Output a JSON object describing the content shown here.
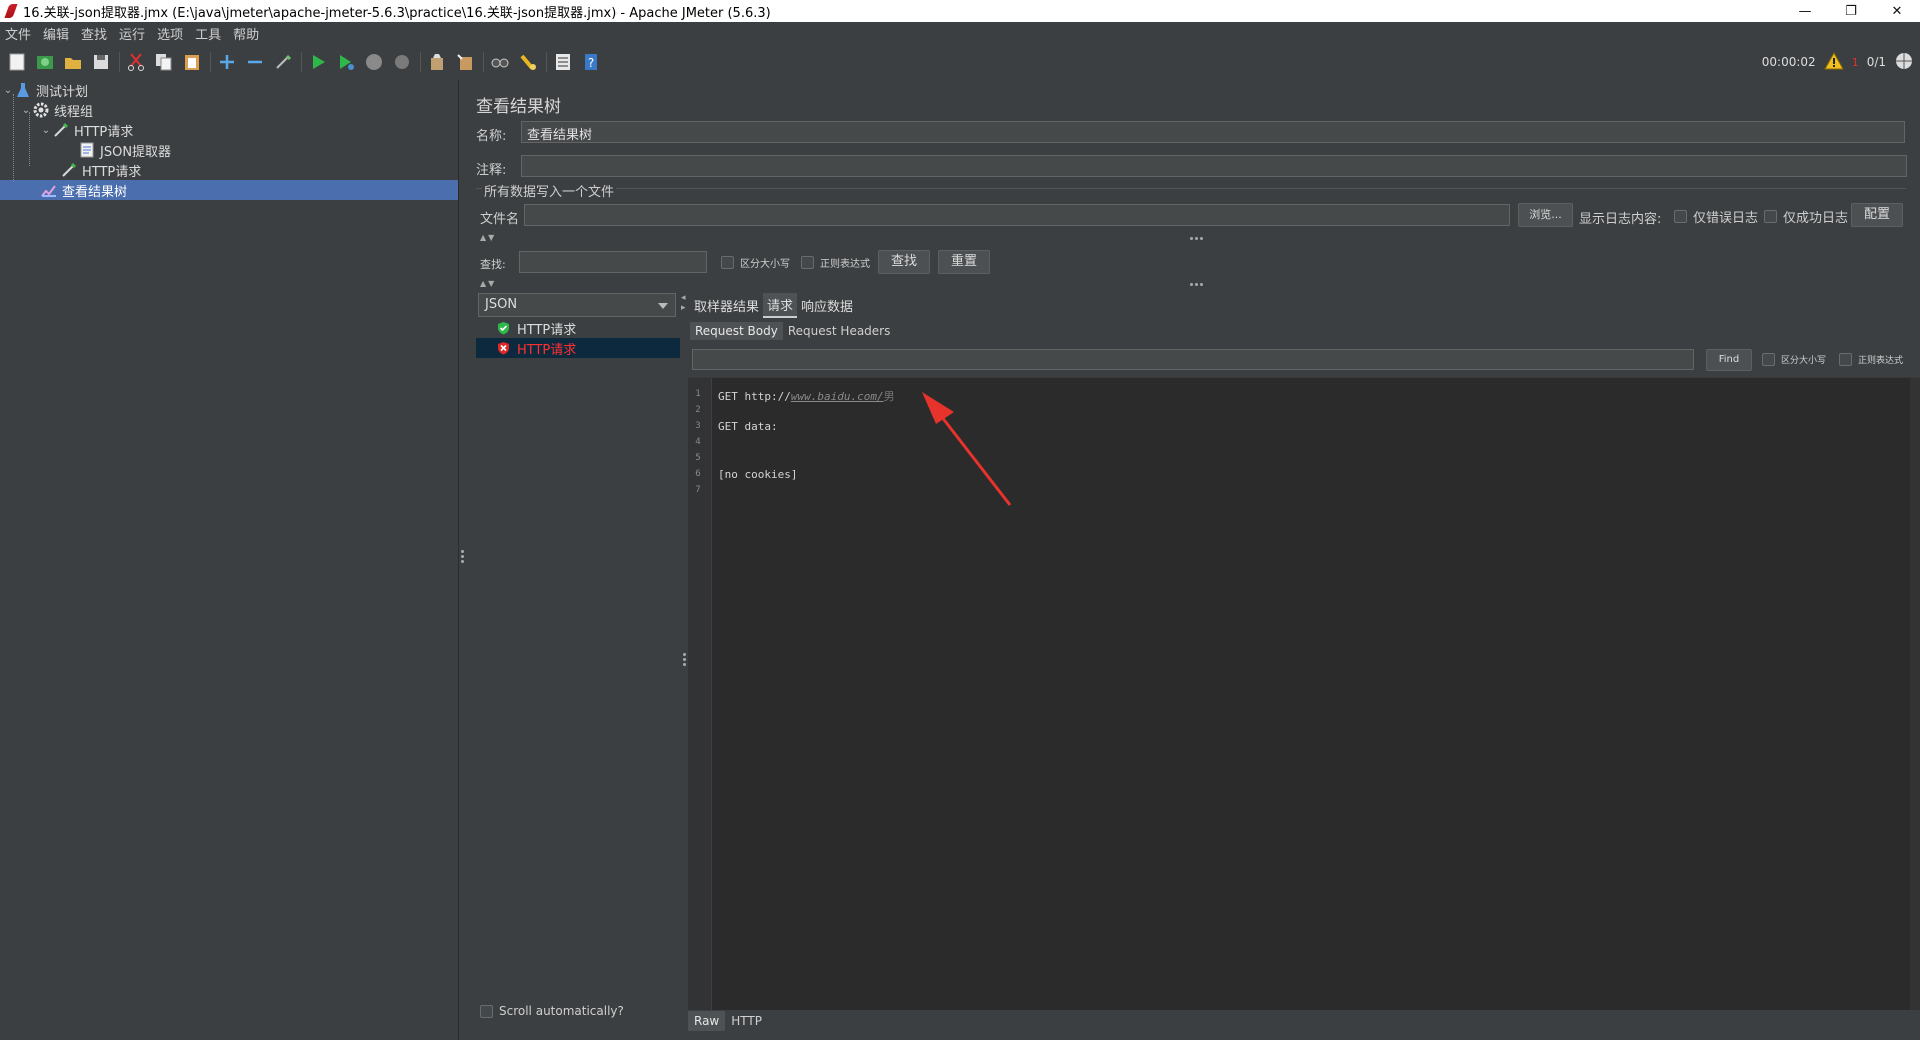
{
  "window": {
    "title": "16.关联-json提取器.jmx (E:\\java\\jmeter\\apache-jmeter-5.6.3\\practice\\16.关联-json提取器.jmx) - Apache JMeter (5.6.3)",
    "min": "—",
    "max": "❐",
    "close": "✕"
  },
  "menu": [
    "文件",
    "编辑",
    "查找",
    "运行",
    "选项",
    "工具",
    "帮助"
  ],
  "status": {
    "timer": "00:00:02",
    "warnings": "0/1",
    "error_count": "1"
  },
  "tree": {
    "test_plan": "测试计划",
    "thread_group": "线程组",
    "http1": "HTTP请求",
    "json_extractor": "JSON提取器",
    "http2": "HTTP请求",
    "view_results": "查看结果树"
  },
  "panel": {
    "title": "查看结果树",
    "name_label": "名称:",
    "name_value": "查看结果树",
    "comment_label": "注释:",
    "comment_value": "",
    "write_all_label": "所有数据写入一个文件",
    "filename_label": "文件名",
    "filename_value": "",
    "browse_label": "浏览...",
    "log_content_label": "显示日志内容:",
    "errors_only_label": "仅错误日志",
    "success_only_label": "仅成功日志",
    "configure_label": "配置",
    "search_label": "查找:",
    "search_value": "",
    "case_sensitive_label": "区分大小写",
    "regex_label": "正则表达式",
    "find_button": "查找",
    "reset_button": "重置"
  },
  "results": {
    "renderer": "JSON",
    "items": [
      {
        "label": "HTTP请求",
        "status": "success",
        "color": "#dcdcdc"
      },
      {
        "label": "HTTP请求",
        "status": "error",
        "color": "#ff3030"
      }
    ],
    "scroll_auto_label": "Scroll automatically?"
  },
  "detail": {
    "tabs": [
      "取样器结果",
      "请求",
      "响应数据"
    ],
    "active_tab": "请求",
    "subtabs": [
      "Request Body",
      "Request Headers"
    ],
    "active_subtab": "Request Body",
    "find_value": "",
    "find_button": "Find",
    "case_label": "区分大小写",
    "regex_label": "正则表达式",
    "lines": [
      "1",
      "2",
      "3",
      "4",
      "5",
      "6",
      "7"
    ],
    "code_line1_prefix": "GET http://",
    "code_line1_url": "www.baidu.com/",
    "code_line1_suffix": "男",
    "code_line3": "GET data:",
    "code_line6": "[no cookies]",
    "bottom_tabs": [
      "Raw",
      "HTTP"
    ]
  },
  "colors": {
    "selection": "#4b6eaf",
    "error_text": "#ff3030",
    "annotation_arrow": "#e8322c",
    "background": "#3c3f41",
    "editor": "#2b2b2b"
  }
}
